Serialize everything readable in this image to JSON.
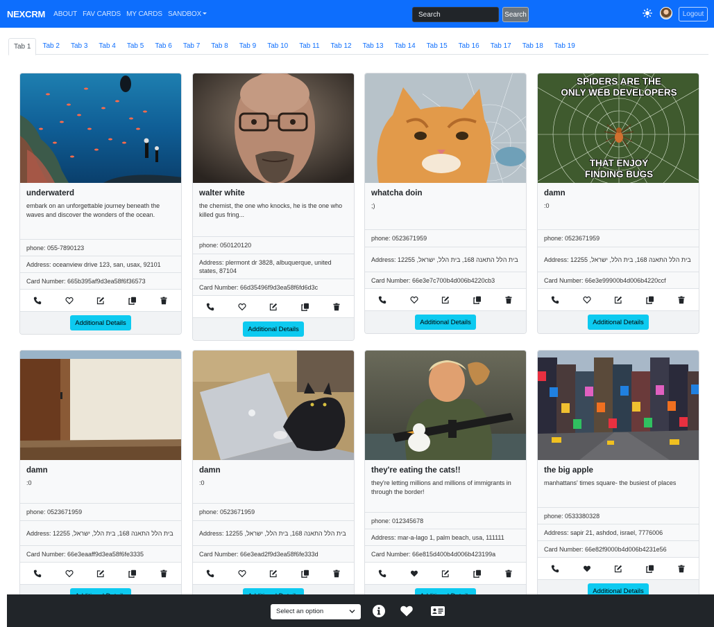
{
  "navbar": {
    "brand": "NEXCRM",
    "links": [
      "ABOUT",
      "FAV CARDS",
      "MY CARDS",
      "SANDBOX"
    ],
    "search_placeholder": "Search",
    "search_button": "Search",
    "logout": "Logout",
    "color": "#0d6efd"
  },
  "tabs": [
    "Tab 1",
    "Tab 2",
    "Tab 3",
    "Tab 4",
    "Tab 5",
    "Tab 6",
    "Tab 7",
    "Tab 8",
    "Tab 9",
    "Tab 10",
    "Tab 11",
    "Tab 12",
    "Tab 13",
    "Tab 14",
    "Tab 15",
    "Tab 16",
    "Tab 17",
    "Tab 18",
    "Tab 19"
  ],
  "active_tab": "Tab 1",
  "details_label": "Additional Details",
  "cards": [
    {
      "title": "underwaterd",
      "text": "embark on an unforgettable journey beneath the waves and discover the wonders of the ocean.",
      "phone": "phone: 055-7890123",
      "address": "Address: oceanview drive 123, san, usax, 92101",
      "card_number": "Card Number: 665b395af9d3ea58f6f36573",
      "liked": false,
      "image": "underwater-reef-image"
    },
    {
      "title": "walter white",
      "text": "the chemist, the one who knocks, he is the one who killed gus fring...",
      "phone": "phone: 050120120",
      "address": "Address: plermont dr 3828, albuquerque, united states, 87104",
      "card_number": "Card Number: 66d35496f9d3ea58f6fd6d3c",
      "liked": false,
      "image": "man-with-glasses-image"
    },
    {
      "title": "whatcha doin",
      "text": ";)",
      "phone": "phone: 0523671959",
      "address": "Address: בית הלל התאנה 168, בית הלל, ישראל, 12255",
      "card_number": "Card Number: 66e3e7c700b4d006b4220cb3",
      "liked": false,
      "image": "cat-selfie-image"
    },
    {
      "title": "damn",
      "text": ":0",
      "phone": "phone: 0523671959",
      "address": "Address: בית הלל התאנה 168, בית הלל, ישראל, 12255",
      "card_number": "Card Number: 66e3e99900b4d006b4220ccf",
      "liked": false,
      "image": "spider-meme-image",
      "meme_top": "SPIDERS ARE THE ONLY WEB DEVELOPERS",
      "meme_bottom": "THAT ENJOY FINDING BUGS"
    },
    {
      "title": "damn",
      "text": ":0",
      "phone": "phone: 0523671959",
      "address": "Address: בית הלל התאנה 168, בית הלל, ישראל, 12255",
      "card_number": "Card Number: 66e3eaaff9d3ea58f6fe3335",
      "liked": false,
      "image": "room-door-image"
    },
    {
      "title": "damn",
      "text": ":0",
      "phone": "phone: 0523671959",
      "address": "Address: בית הלל התאנה 168, בית הלל, ישראל, 12255",
      "card_number": "Card Number: 66e3ead2f9d3ea58f6fe333d",
      "liked": false,
      "image": "cat-laptop-image"
    },
    {
      "title": "they're eating the cats!!",
      "text": "they're letting millions and millions of immigrants in through the border!",
      "phone": "phone: 012345678",
      "address": "Address: mar-a-lago 1, palm beach, usa, 111111",
      "card_number": "Card Number: 66e815d400b4d006b423199a",
      "liked": true,
      "image": "soldier-cat-duck-image"
    },
    {
      "title": "the big apple",
      "text": "manhattans' times square- the busiest of places",
      "phone": "phone: 0533380328",
      "address": "Address: sapir 21, ashdod, israel, 7776006",
      "card_number": "Card Number: 66e82f9000b4d006b4231e56",
      "liked": true,
      "image": "times-square-image"
    }
  ],
  "bottom": {
    "select_label": "Select an option"
  }
}
